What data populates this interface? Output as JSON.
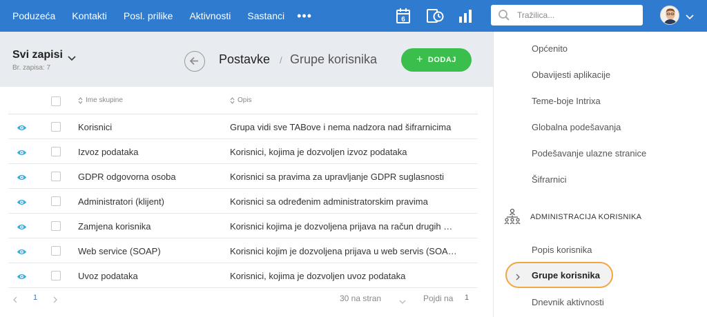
{
  "nav": {
    "items": [
      "Poduzeća",
      "Kontakti",
      "Posl. prilike",
      "Aktivnosti",
      "Sastanci"
    ],
    "more": "•••",
    "calendar_day": "6"
  },
  "search": {
    "placeholder": "Tražilica..."
  },
  "header": {
    "records_title": "Svi zapisi",
    "records_count": "Br. zapisa: 7",
    "breadcrumb_parent": "Postavke",
    "breadcrumb_sep": "/",
    "breadcrumb_current": "Grupe korisnika",
    "add_label": "DODAJ",
    "add_plus": "+"
  },
  "table": {
    "columns": [
      "Ime skupine",
      "Opis"
    ],
    "rows": [
      {
        "name": "Korisnici",
        "desc": "Grupa vidi sve TABove i nema nadzora nad šifrarnicima"
      },
      {
        "name": "Izvoz podataka",
        "desc": "Korisnici, kojima je dozvoljen izvoz podataka"
      },
      {
        "name": "GDPR odgovorna osoba",
        "desc": "Korisnici sa pravima za upravljanje GDPR suglasnosti"
      },
      {
        "name": "Administratori (klijent)",
        "desc": "Korisnici sa određenim administratorskim pravima"
      },
      {
        "name": "Zamjena korisnika",
        "desc": "Korisnici kojima je dozvoljena prijava na račun drugih …"
      },
      {
        "name": "Web service (SOAP)",
        "desc": "Korisnici kojim je dozvoljena prijava u web servis (SOA…"
      },
      {
        "name": "Uvoz podataka",
        "desc": "Korisnici, kojima je dozvoljen uvoz podataka"
      }
    ]
  },
  "pager": {
    "page": "1",
    "per_page": "30 na stran",
    "goto_label": "Pojdi na",
    "goto_value": "1"
  },
  "settings_menu": {
    "items": [
      "Općenito",
      "Obavijesti aplikacije",
      "Teme-boje Intrixa",
      "Globalna podešavanja",
      "Podešavanje ulazne stranice",
      "Šifrarnici"
    ],
    "section_title": "ADMINISTRACIJA KORISNIKA",
    "section_items": [
      "Popis korisnika",
      "Grupe korisnika",
      "Dnevnik aktivnosti"
    ]
  },
  "colors": {
    "topbar": "#2e7bcf",
    "add_button": "#3bbf4c",
    "active_outline": "#f2a640",
    "eye_icon": "#3fa9d8"
  }
}
